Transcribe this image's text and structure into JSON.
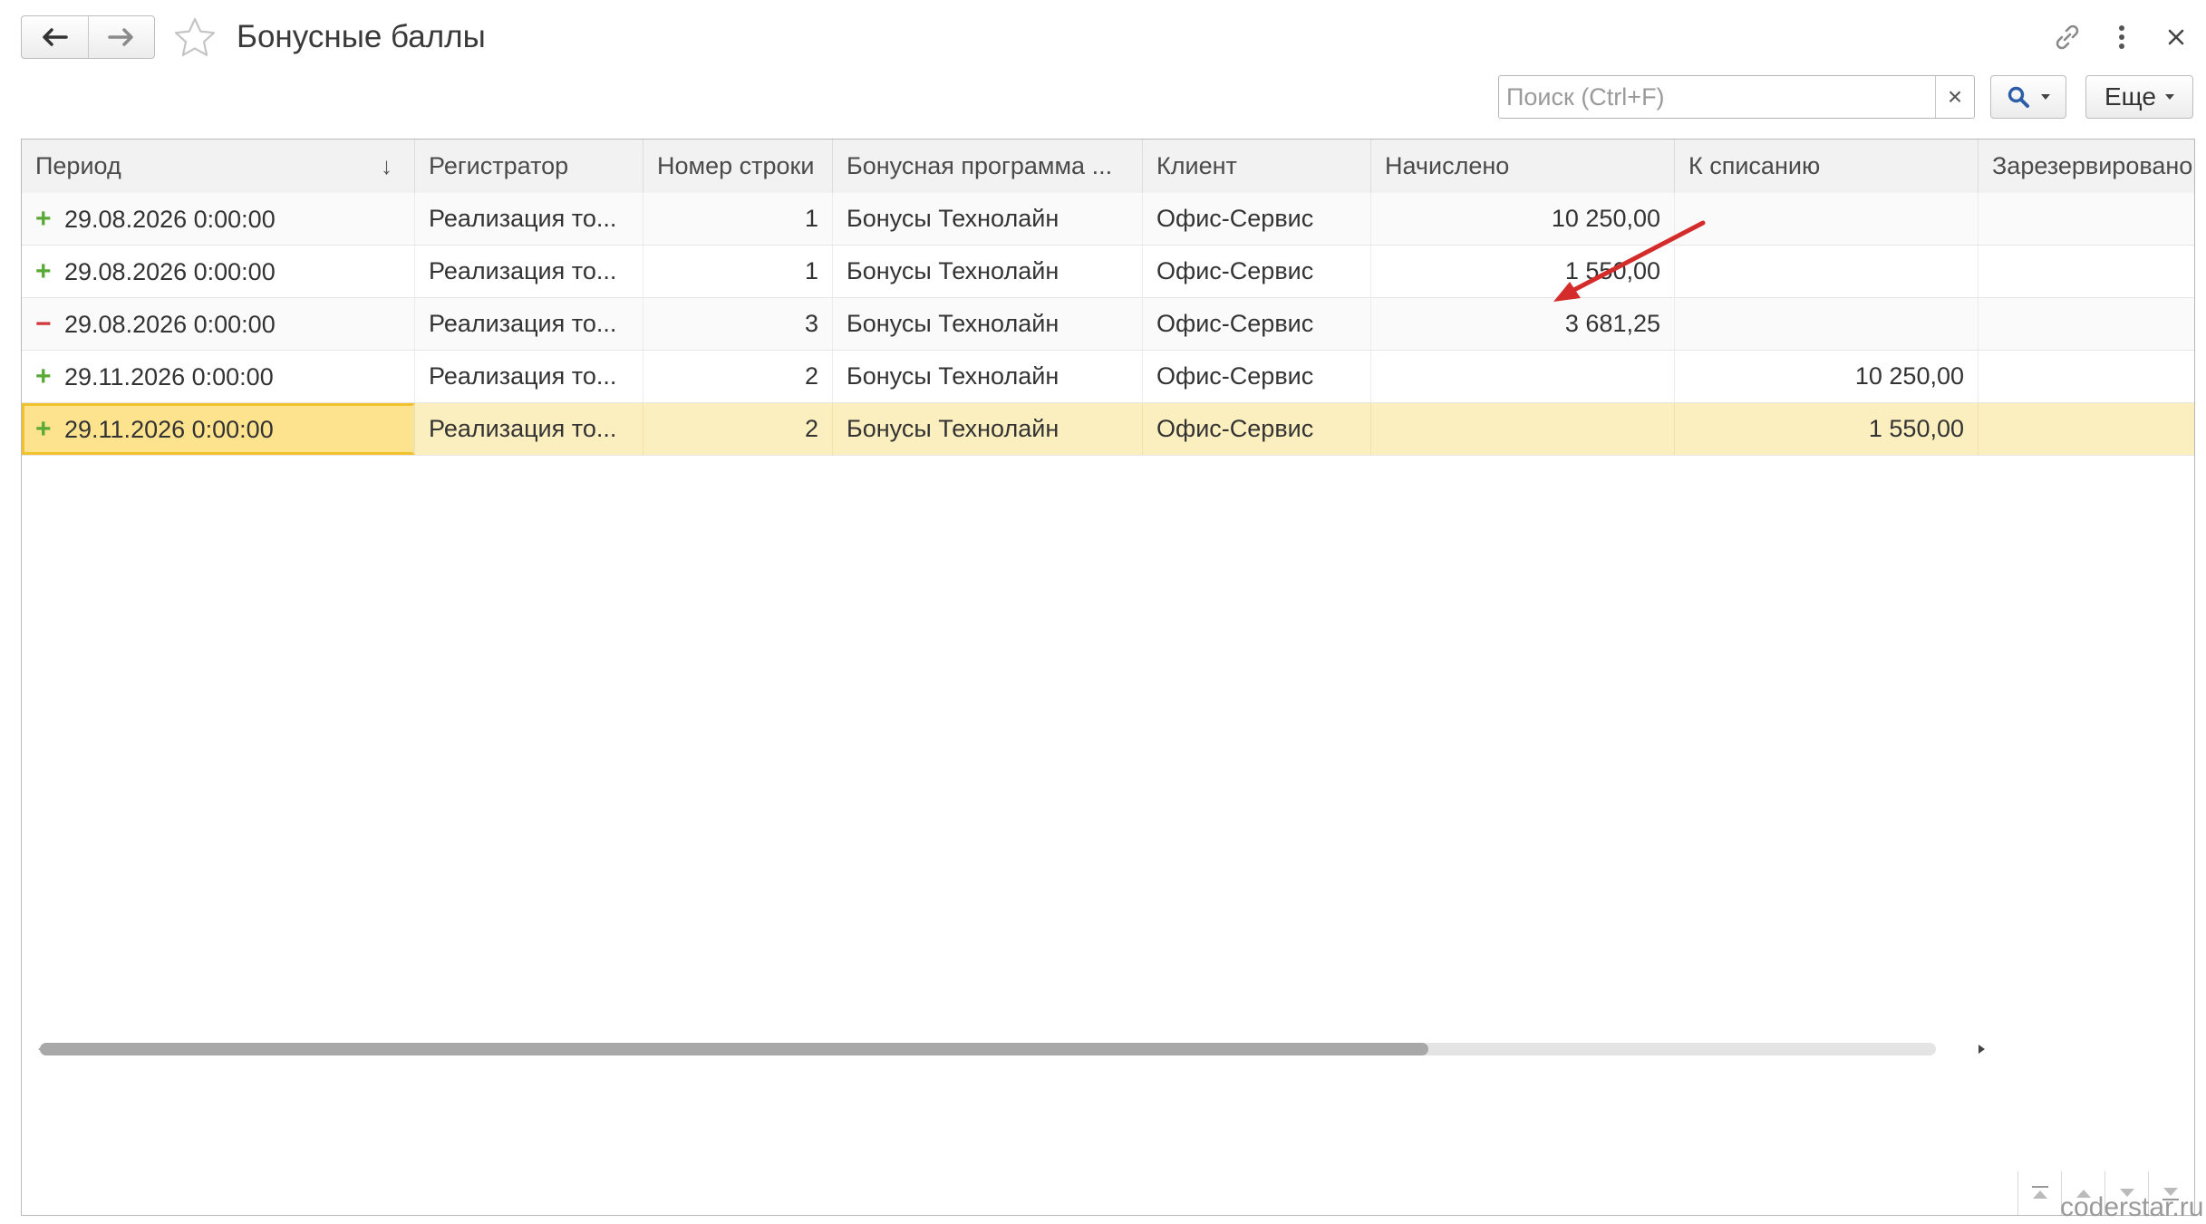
{
  "window": {
    "title": "Бонусные баллы",
    "nav": {
      "back_icon": "arrow-left-icon",
      "forward_icon": "arrow-right-icon"
    },
    "favorite_icon": "star-icon",
    "actions": {
      "link_icon": "link-icon",
      "menu_icon": "kebab-menu-icon",
      "close_icon": "close-icon"
    }
  },
  "toolbar": {
    "search_placeholder": "Поиск (Ctrl+F)",
    "search_value": "",
    "clear_label": "×",
    "search_icon": "magnifier-icon",
    "more_label": "Еще"
  },
  "table": {
    "columns": [
      {
        "key": "period",
        "label": "Период",
        "sorted": "desc"
      },
      {
        "key": "registrar",
        "label": "Регистратор"
      },
      {
        "key": "line_no",
        "label": "Номер строки"
      },
      {
        "key": "program",
        "label": "Бонусная программа ..."
      },
      {
        "key": "client",
        "label": "Клиент"
      },
      {
        "key": "accrued",
        "label": "Начислено"
      },
      {
        "key": "to_writeoff",
        "label": "К списанию"
      },
      {
        "key": "reserved",
        "label": "Зарезервировано"
      }
    ],
    "sort_icon": "↓",
    "rows": [
      {
        "sign": "+",
        "type": "plus",
        "period": "29.08.2026 0:00:00",
        "registrar": "Реализация то...",
        "line_no": "1",
        "program": "Бонусы Технолайн",
        "client": "Офис-Сервис",
        "accrued": "10 250,00",
        "to_writeoff": "",
        "reserved": ""
      },
      {
        "sign": "+",
        "type": "plus",
        "period": "29.08.2026 0:00:00",
        "registrar": "Реализация то...",
        "line_no": "1",
        "program": "Бонусы Технолайн",
        "client": "Офис-Сервис",
        "accrued": "1 550,00",
        "to_writeoff": "",
        "reserved": ""
      },
      {
        "sign": "−",
        "type": "minus",
        "period": "29.08.2026 0:00:00",
        "registrar": "Реализация то...",
        "line_no": "3",
        "program": "Бонусы Технолайн",
        "client": "Офис-Сервис",
        "accrued": "3 681,25",
        "to_writeoff": "",
        "reserved": ""
      },
      {
        "sign": "+",
        "type": "plus",
        "period": "29.11.2026 0:00:00",
        "registrar": "Реализация то...",
        "line_no": "2",
        "program": "Бонусы Технолайн",
        "client": "Офис-Сервис",
        "accrued": "",
        "to_writeoff": "10 250,00",
        "reserved": ""
      },
      {
        "sign": "+",
        "type": "plus",
        "period": "29.11.2026 0:00:00",
        "registrar": "Реализация то...",
        "line_no": "2",
        "program": "Бонусы Технолайн",
        "client": "Офис-Сервис",
        "accrued": "",
        "to_writeoff": "1 550,00",
        "reserved": ""
      }
    ],
    "selected_row": 4
  },
  "annotation": {
    "arrow_color": "#d42b2b"
  },
  "watermark": "coderstar.ru",
  "colors": {
    "selection": "#fcefbf",
    "active_cell": "#fde38e",
    "active_border": "#f1c12e",
    "plus": "#58a935",
    "minus": "#d2383a"
  }
}
